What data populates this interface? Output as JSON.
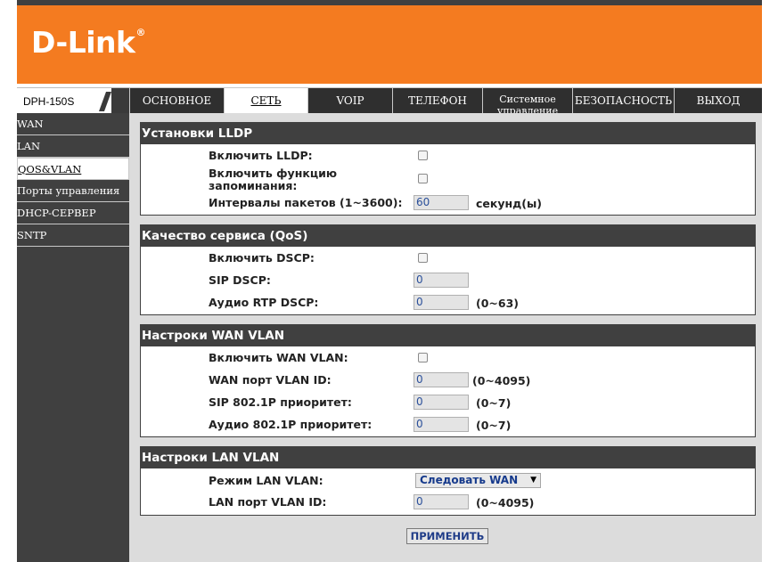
{
  "brand": {
    "logo_text": "D-Link",
    "registered_mark": "®",
    "model": "DPH-150S"
  },
  "tabs": [
    {
      "label": "ОСНОВНОЕ",
      "active": false
    },
    {
      "label": "СЕТЬ",
      "active": true
    },
    {
      "label": "VOIP",
      "active": false
    },
    {
      "label": "ТЕЛЕФОН",
      "active": false
    },
    {
      "label": "Системное управление",
      "active": false
    },
    {
      "label": "БЕЗОПАСНОСТЬ",
      "active": false
    },
    {
      "label": "ВЫХОД",
      "active": false
    }
  ],
  "sidebar": {
    "items": [
      {
        "label": "WAN"
      },
      {
        "label": "LAN"
      },
      {
        "label": "QOS&VLAN",
        "active": true
      },
      {
        "label": "Порты управления"
      },
      {
        "label": "DHCP-СЕРВЕР"
      },
      {
        "label": "SNTP"
      }
    ]
  },
  "lldp": {
    "title": "Установки LLDP",
    "enable_label": "Включить LLDP:",
    "learn_label": "Включить функцию запоминания:",
    "interval_label": "Интервалы пакетов (1~3600):",
    "interval_value": "60",
    "interval_unit": "секунд(ы)"
  },
  "qos": {
    "title": "Качество сервиса (QoS)",
    "enable_label": "Включить DSCP:",
    "sip_label": "SIP DSCP:",
    "sip_value": "0",
    "rtp_label": "Аудио RTP DSCP:",
    "rtp_value": "0",
    "rtp_range": "(0~63)"
  },
  "wan_vlan": {
    "title": "Настроки WAN VLAN",
    "enable_label": "Включить WAN VLAN:",
    "id_label": "WAN порт VLAN ID:",
    "id_value": "0",
    "id_range": "(0~4095)",
    "sip_label": "SIP 802.1P приоритет:",
    "sip_value": "0",
    "sip_range": "(0~7)",
    "audio_label": "Аудио 802.1P приоритет:",
    "audio_value": "0",
    "audio_range": "(0~7)"
  },
  "lan_vlan": {
    "title": "Настроки LAN VLAN",
    "mode_label": "Режим LAN VLAN:",
    "mode_value": "Следовать WAN",
    "id_label": "LAN порт VLAN ID:",
    "id_value": "0",
    "id_range": "(0~4095)"
  },
  "apply_label": "ПРИМЕНИТЬ",
  "colors": {
    "brand_orange": "#f47b20",
    "dark_gray": "#404040"
  }
}
